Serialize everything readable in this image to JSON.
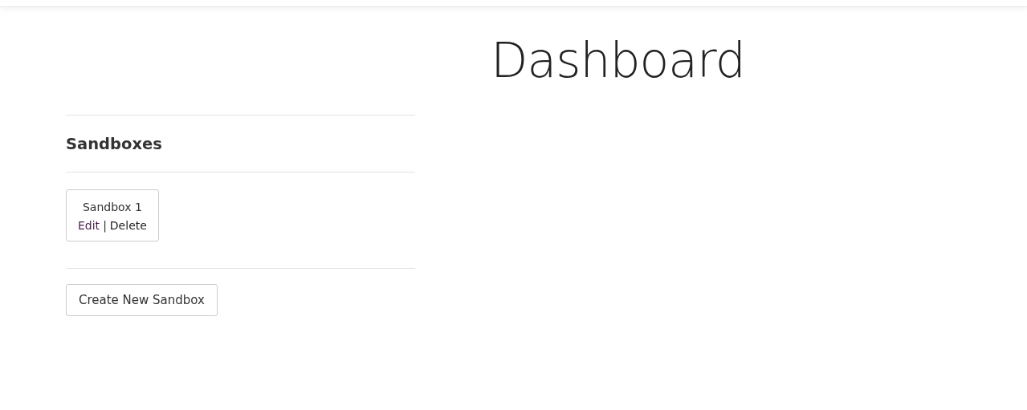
{
  "page_title": "Dashboard",
  "sidebar": {
    "heading": "Sandboxes",
    "sandboxes": [
      {
        "name": "Sandbox 1",
        "actions": [
          {
            "label": "Edit",
            "visited": true
          },
          {
            "label": "Delete",
            "visited": false
          }
        ],
        "separator": "|"
      }
    ],
    "create_button": "Create New Sandbox"
  }
}
